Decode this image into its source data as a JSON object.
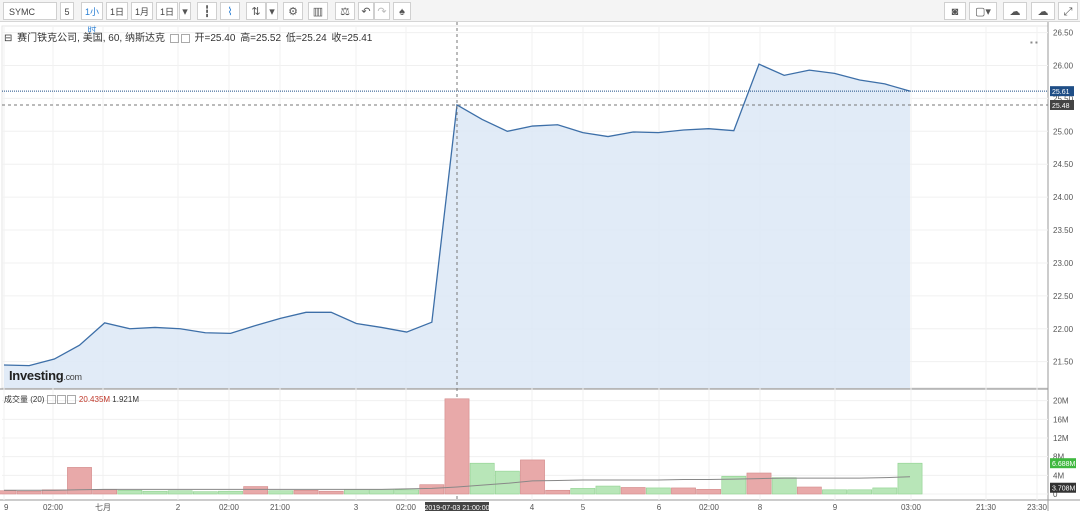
{
  "toolbar": {
    "symbol": "SYMC",
    "interval": "5",
    "ranges": [
      "1小时",
      "1日",
      "1月",
      "1日"
    ],
    "active_range": 0
  },
  "legend": {
    "name": "赛门铁克公司, 美国, 60, 纳斯达克",
    "open": "开=25.40",
    "high": "高=25.52",
    "low": "低=25.24",
    "close": "收=25.41"
  },
  "volume_legend": {
    "label": "成交量 (20)",
    "v1": "20.435M",
    "v2": "1.921M"
  },
  "logo": {
    "main": "Investing",
    "suffix": ".com"
  },
  "colors": {
    "line": "#3d6fa8",
    "area": "#dce8f6",
    "vol_up": "#b8e6b8",
    "vol_down": "#e8a9a9",
    "last_tag": "#1f4e86",
    "cross_tag": "#444444",
    "vol_tag_up": "#3fb83f"
  },
  "chart_data": [
    {
      "type": "area",
      "y_ticks": [
        "26.50",
        "26.00",
        "25.50",
        "25.00",
        "24.50",
        "24.00",
        "23.50",
        "23.00",
        "22.50",
        "22.00",
        "21.50"
      ],
      "ylim": [
        21.1,
        26.6
      ],
      "values": [
        21.45,
        21.44,
        21.54,
        21.75,
        22.09,
        22.0,
        22.02,
        22.0,
        21.94,
        21.93,
        22.05,
        22.16,
        22.25,
        22.25,
        22.08,
        22.02,
        21.95,
        22.1,
        25.4,
        25.18,
        25.0,
        25.08,
        25.1,
        24.98,
        24.92,
        24.99,
        24.98,
        25.02,
        25.04,
        25.01,
        26.02,
        25.85,
        25.93,
        25.88,
        25.78,
        25.72,
        25.61
      ],
      "last_value_label": "25.61",
      "crosshair_value_label": "25.48",
      "crosshair_value": 25.4
    },
    {
      "type": "bar",
      "y_ticks": [
        "20M",
        "16M",
        "12M",
        "8M",
        "4M",
        "0"
      ],
      "ylim": [
        0,
        21
      ],
      "values": [
        0.7,
        0.6,
        0.9,
        5.7,
        0.9,
        0.8,
        0.6,
        0.7,
        0.5,
        0.6,
        1.6,
        0.7,
        0.8,
        0.6,
        1.0,
        1.0,
        0.9,
        2.0,
        20.4,
        6.6,
        4.9,
        7.3,
        0.8,
        1.2,
        1.7,
        1.4,
        1.3,
        1.3,
        1.0,
        3.8,
        4.5,
        3.5,
        1.5,
        0.9,
        0.9,
        1.3,
        6.6
      ],
      "directions": [
        "d",
        "d",
        "d",
        "d",
        "d",
        "u",
        "u",
        "u",
        "u",
        "u",
        "d",
        "u",
        "d",
        "d",
        "u",
        "u",
        "u",
        "d",
        "d",
        "u",
        "u",
        "d",
        "d",
        "u",
        "u",
        "d",
        "u",
        "d",
        "d",
        "u",
        "d",
        "u",
        "d",
        "u",
        "u",
        "u",
        "u"
      ],
      "ma": [
        0.8,
        0.8,
        0.8,
        0.9,
        1.0,
        1.0,
        1.0,
        1.0,
        1.0,
        1.0,
        1.0,
        1.0,
        1.0,
        1.0,
        1.0,
        1.0,
        1.1,
        1.2,
        1.5,
        1.9,
        2.3,
        2.8,
        2.9,
        3.0,
        3.0,
        3.0,
        3.0,
        3.1,
        3.1,
        3.2,
        3.3,
        3.4,
        3.4,
        3.4,
        3.4,
        3.5,
        3.7
      ],
      "ma_label": "3.708M",
      "last_volume_label": "6.688M"
    }
  ],
  "x_ticks": [
    "9",
    "02:00",
    "七月",
    "2",
    "02:00",
    "21:00",
    "3",
    "02:00",
    "4",
    "5",
    "6",
    "02:00",
    "8",
    "9",
    "03:00",
    "21:30",
    "23:30"
  ],
  "x_crosshair_label": "2019-07-03 21:00:00"
}
